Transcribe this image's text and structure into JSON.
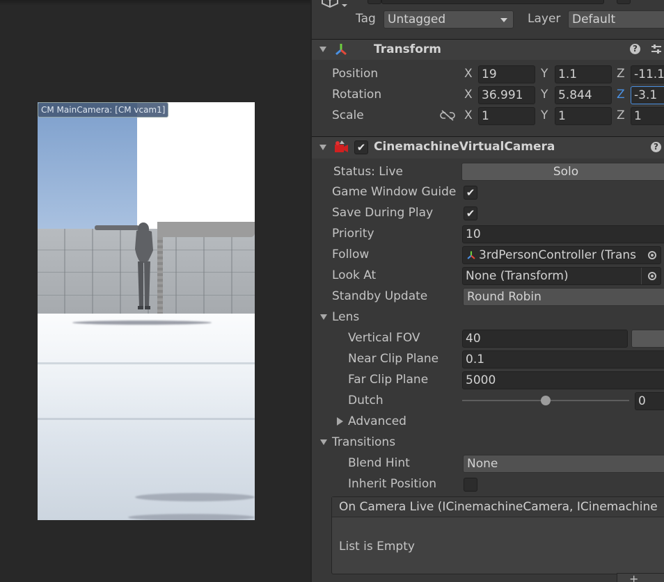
{
  "game_view": {
    "camera_label": "CM MainCamera: [CM vcam1]"
  },
  "inspector": {
    "object_header": {
      "tag_label": "Tag",
      "tag_value": "Untagged",
      "layer_label": "Layer",
      "layer_value": "Default"
    },
    "transform": {
      "title": "Transform",
      "position_label": "Position",
      "rotation_label": "Rotation",
      "scale_label": "Scale",
      "axis_x": "X",
      "axis_y": "Y",
      "axis_z": "Z",
      "position": {
        "x": "19",
        "y": "1.1",
        "z": "-11.1"
      },
      "rotation": {
        "x": "36.991",
        "y": "5.844",
        "z": "-3.1"
      },
      "scale": {
        "x": "1",
        "y": "1",
        "z": "1"
      }
    },
    "vcam": {
      "title": "CinemachineVirtualCamera",
      "enabled": true,
      "status_label": "Status: Live",
      "solo_button": "Solo",
      "game_window_guides_label": "Game Window Guide",
      "game_window_guides_checked": true,
      "save_during_play_label": "Save During Play",
      "save_during_play_checked": true,
      "priority_label": "Priority",
      "priority_value": "10",
      "follow_label": "Follow",
      "follow_value": "3rdPersonController (Trans",
      "look_at_label": "Look At",
      "look_at_value": "None (Transform)",
      "standby_update_label": "Standby Update",
      "standby_update_value": "Round Robin",
      "lens_label": "Lens",
      "vertical_fov_label": "Vertical FOV",
      "vertical_fov_value": "40",
      "near_clip_label": "Near Clip Plane",
      "near_clip_value": "0.1",
      "far_clip_label": "Far Clip Plane",
      "far_clip_value": "5000",
      "dutch_label": "Dutch",
      "dutch_value": "0",
      "dutch_slider_fraction": 0.5,
      "advanced_label": "Advanced",
      "transitions_label": "Transitions",
      "blend_hint_label": "Blend Hint",
      "blend_hint_value": "None",
      "inherit_position_label": "Inherit Position",
      "inherit_position_checked": false,
      "on_camera_live_label": "On Camera Live (ICinemachineCamera, ICinemachine",
      "list_empty_text": "List is Empty",
      "add_button": "+"
    },
    "icons": [
      "cube-icon",
      "transform-axes-icon",
      "help-icon",
      "preset-icon",
      "vcam-component-icon",
      "object-picker-icon",
      "unlink-icon"
    ],
    "colors": {
      "panel": "#383838",
      "field": "#2a2a2a",
      "accent_z": "#4a90e2"
    }
  }
}
